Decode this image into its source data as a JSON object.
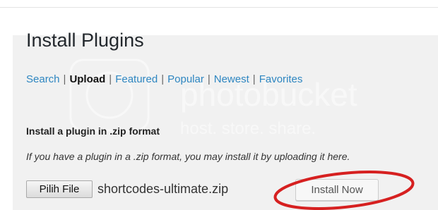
{
  "page": {
    "title": "Install Plugins"
  },
  "tabs": [
    {
      "label": "Search",
      "current": false
    },
    {
      "label": "Upload",
      "current": true
    },
    {
      "label": "Featured",
      "current": false
    },
    {
      "label": "Popular",
      "current": false
    },
    {
      "label": "Newest",
      "current": false
    },
    {
      "label": "Favorites",
      "current": false
    }
  ],
  "tab_separator": "|",
  "upload": {
    "section_title": "Install a plugin in .zip format",
    "help_text": "If you have a plugin in a .zip format, you may install it by uploading it here.",
    "choose_file_label": "Pilih File",
    "selected_file": "shortcodes-ultimate.zip",
    "install_button_label": "Install Now"
  },
  "watermark": {
    "brand": "photobucket",
    "tagline": "host. store. share."
  },
  "colors": {
    "link": "#2e86c1",
    "annotation": "#d62020",
    "content_bg": "#f1f1f1"
  }
}
